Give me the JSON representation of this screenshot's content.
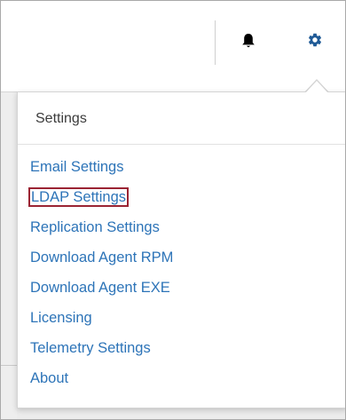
{
  "topbar": {
    "icons": [
      "bell-icon",
      "gear-icon"
    ],
    "accent_color": "#1f5a96"
  },
  "settings_menu": {
    "title": "Settings",
    "items": [
      {
        "label": "Email Settings"
      },
      {
        "label": "LDAP Settings",
        "highlighted": true
      },
      {
        "label": "Replication Settings"
      },
      {
        "label": "Download Agent RPM"
      },
      {
        "label": "Download Agent EXE"
      },
      {
        "label": "Licensing"
      },
      {
        "label": "Telemetry Settings"
      },
      {
        "label": "About"
      }
    ],
    "link_color": "#2d74b8",
    "highlight_color": "#9b2433"
  }
}
